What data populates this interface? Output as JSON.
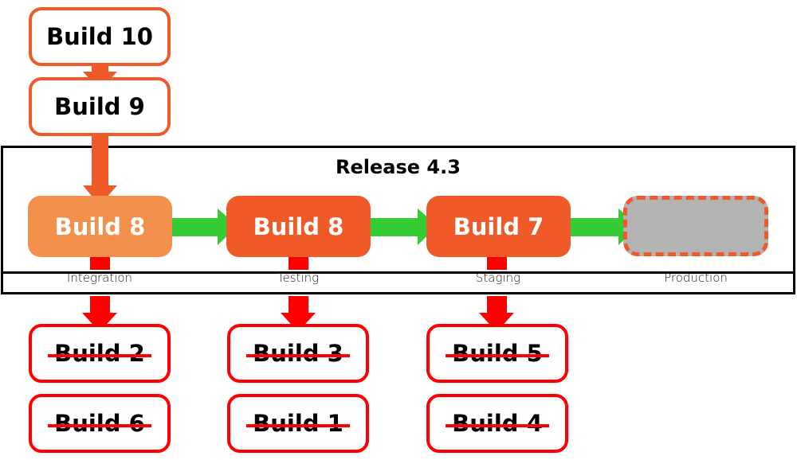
{
  "colors": {
    "queued_border": "#f05a28",
    "flow_arrow": "#f05a28",
    "integration_fill": "#f3914c",
    "stage_fill": "#f05a28",
    "promote_arrow": "#33cc33",
    "reject": "#ff0000",
    "placeholder_fill": "#b3b3b3"
  },
  "queue": [
    {
      "label": "Build 10"
    },
    {
      "label": "Build 9"
    }
  ],
  "release": {
    "title": "Release 4.3",
    "stages": [
      {
        "name": "Integration",
        "build": "Build 8"
      },
      {
        "name": "Testing",
        "build": "Build 8"
      },
      {
        "name": "Staging",
        "build": "Build 7"
      },
      {
        "name": "Production",
        "build": ""
      }
    ]
  },
  "rejected": [
    {
      "stage": "Integration",
      "builds": [
        "Build 2",
        "Build 6"
      ]
    },
    {
      "stage": "Testing",
      "builds": [
        "Build 3",
        "Build 1"
      ]
    },
    {
      "stage": "Staging",
      "builds": [
        "Build 5",
        "Build 4"
      ]
    }
  ]
}
